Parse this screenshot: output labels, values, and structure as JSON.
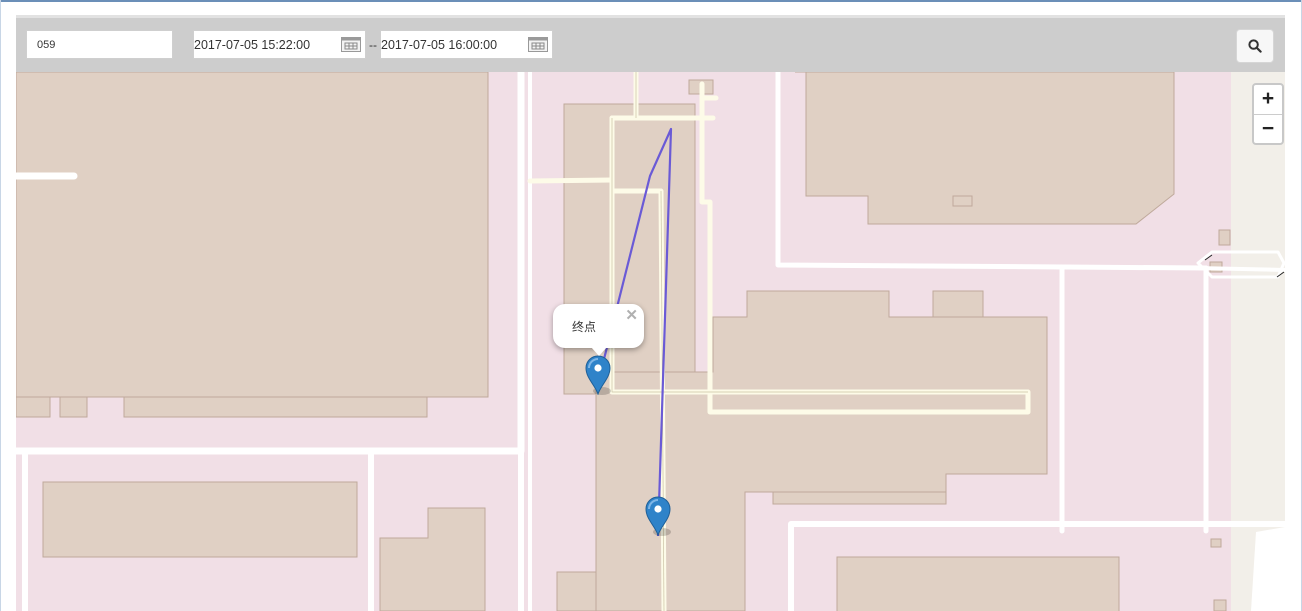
{
  "toolbar": {
    "vehicle_value": "059",
    "start_time": "2017-07-05 15:22:00",
    "separator": "--",
    "end_time": "2017-07-05 16:00:00",
    "search_icon": "search-icon",
    "calendar_icon": "calendar-icon"
  },
  "map": {
    "zoom_in_label": "+",
    "zoom_out_label": "−",
    "popup": {
      "text": "终点",
      "close_label": "✕"
    },
    "colors": {
      "route": "#6a5ad6",
      "marker": "#2f83c9",
      "building": "#e0d0c4",
      "land": "#f1dfe6",
      "road": "#ffffff",
      "footpath": "#fdfbe8"
    }
  }
}
